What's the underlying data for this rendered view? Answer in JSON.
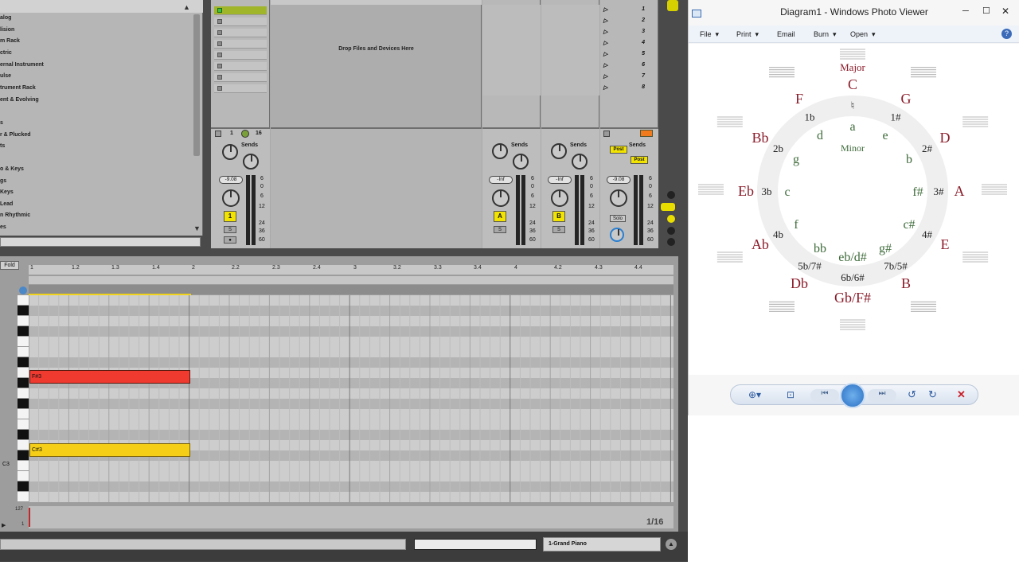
{
  "browser": {
    "items": [
      "alog",
      "lision",
      "m Rack",
      "ctric",
      "ernal Instrument",
      "ulse",
      "trument Rack",
      "ent & Evolving",
      "",
      "s",
      "r & Plucked",
      "ts",
      "",
      "o & Keys",
      "gs",
      "Keys",
      "Lead",
      "n Rhythmic",
      "es"
    ]
  },
  "session": {
    "drop_hint": "Drop Files and Devices Here",
    "scenes": [
      "1",
      "2",
      "3",
      "4",
      "5",
      "6",
      "7",
      "8"
    ],
    "tracks": [
      {
        "num": "1",
        "io": "16",
        "volume": "-9.08",
        "button": "1"
      },
      {
        "volume": "-Inf",
        "button": "A"
      },
      {
        "volume": "-Inf",
        "button": "B"
      },
      {
        "volume": "-9.08",
        "button": "Solo"
      }
    ],
    "sends_label": "Sends",
    "knob_a": "A",
    "knob_b": "B",
    "solo_label": "S",
    "post_label": "Post",
    "db_scale": [
      "6",
      "0",
      "6",
      "12",
      "24",
      "36",
      "60"
    ]
  },
  "clip": {
    "fold_label": "Fold",
    "ruler": [
      "1",
      "1.2",
      "1.3",
      "1.4",
      "2",
      "2.2",
      "2.3",
      "2.4",
      "3",
      "3.2",
      "3.3",
      "3.4",
      "4",
      "4.2",
      "4.3",
      "4.4"
    ],
    "notes": [
      {
        "label": "F#3",
        "color": "#ef3a30"
      },
      {
        "label": "C#3",
        "color": "#f5cf17"
      }
    ],
    "c3_label": "C3",
    "velocity_top": "127",
    "velocity_bottom": "1",
    "grid_label": "1/16"
  },
  "status": {
    "track_name": "1-Grand Piano"
  },
  "viewer": {
    "title": "Diagram1 - Windows Photo Viewer",
    "menu": [
      "File",
      "Print",
      "Email",
      "Burn",
      "Open"
    ],
    "diagram": {
      "major_label": "Major",
      "minor_label": "Minor",
      "major_keys": [
        "C",
        "G",
        "D",
        "A",
        "E",
        "B",
        "Gb/F#",
        "Db",
        "Ab",
        "Eb",
        "Bb",
        "F"
      ],
      "minor_keys": [
        "a",
        "e",
        "b",
        "f#",
        "c#",
        "g#",
        "eb/d#",
        "bb",
        "f",
        "c",
        "g",
        "d"
      ],
      "counts": [
        "♮",
        "1#",
        "2#",
        "3#",
        "4#",
        "7b/5#",
        "6b/6#",
        "5b/7#",
        "4b",
        "3b",
        "2b",
        "1b"
      ]
    }
  },
  "colors": {
    "note_red": "#ef3a30",
    "note_yellow": "#f5cf17",
    "diagram_major": "#8a1c2a",
    "diagram_minor": "#3e6b3a"
  }
}
